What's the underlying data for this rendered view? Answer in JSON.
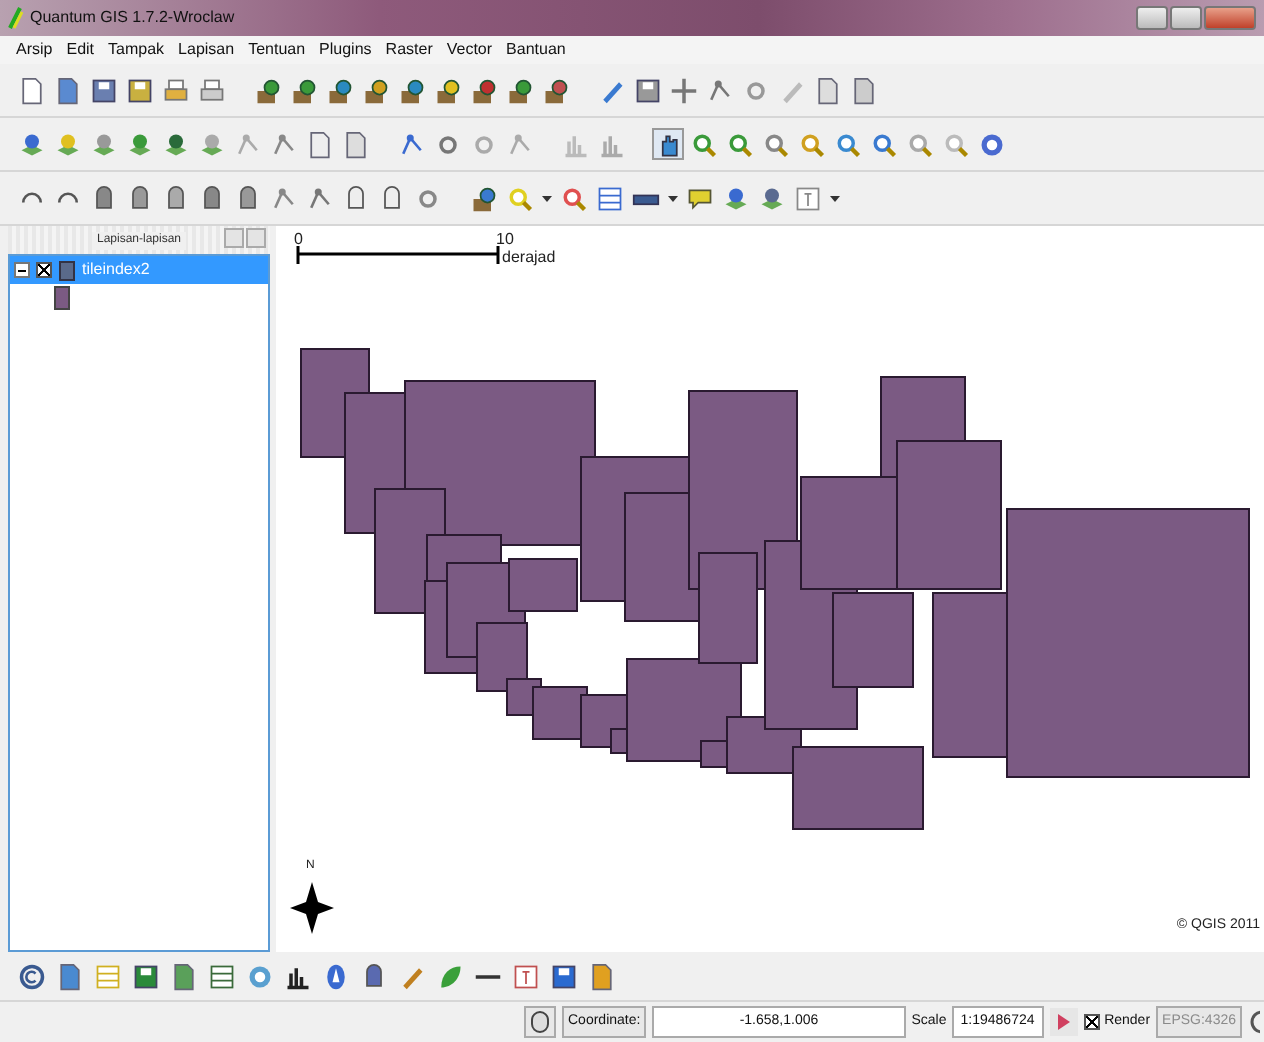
{
  "window": {
    "title": "Quantum GIS 1.7.2-Wroclaw"
  },
  "menu": [
    "Arsip",
    "Edit",
    "Tampak",
    "Lapisan",
    "Tentuan",
    "Plugins",
    "Raster",
    "Vector",
    "Bantuan"
  ],
  "layers_panel": {
    "title": "Lapisan-lapisan",
    "layers": [
      {
        "name": "tileindex2",
        "expanded": true,
        "visible": true,
        "selected": true,
        "color": "#7b5a83"
      }
    ]
  },
  "map": {
    "scale_bar": {
      "start": "0",
      "end": "10",
      "unit": "derajad"
    },
    "north_arrow": "N",
    "copyright": "© QGIS 2011"
  },
  "status_bar": {
    "coordinate_label": "Coordinate:",
    "coordinate": "-1.658,1.006",
    "scale_label": "Scale",
    "scale": "1:19486724",
    "render": {
      "label": "Render",
      "checked": true
    },
    "crs": {
      "label": "EPSG:4326",
      "disabled": true
    }
  }
}
